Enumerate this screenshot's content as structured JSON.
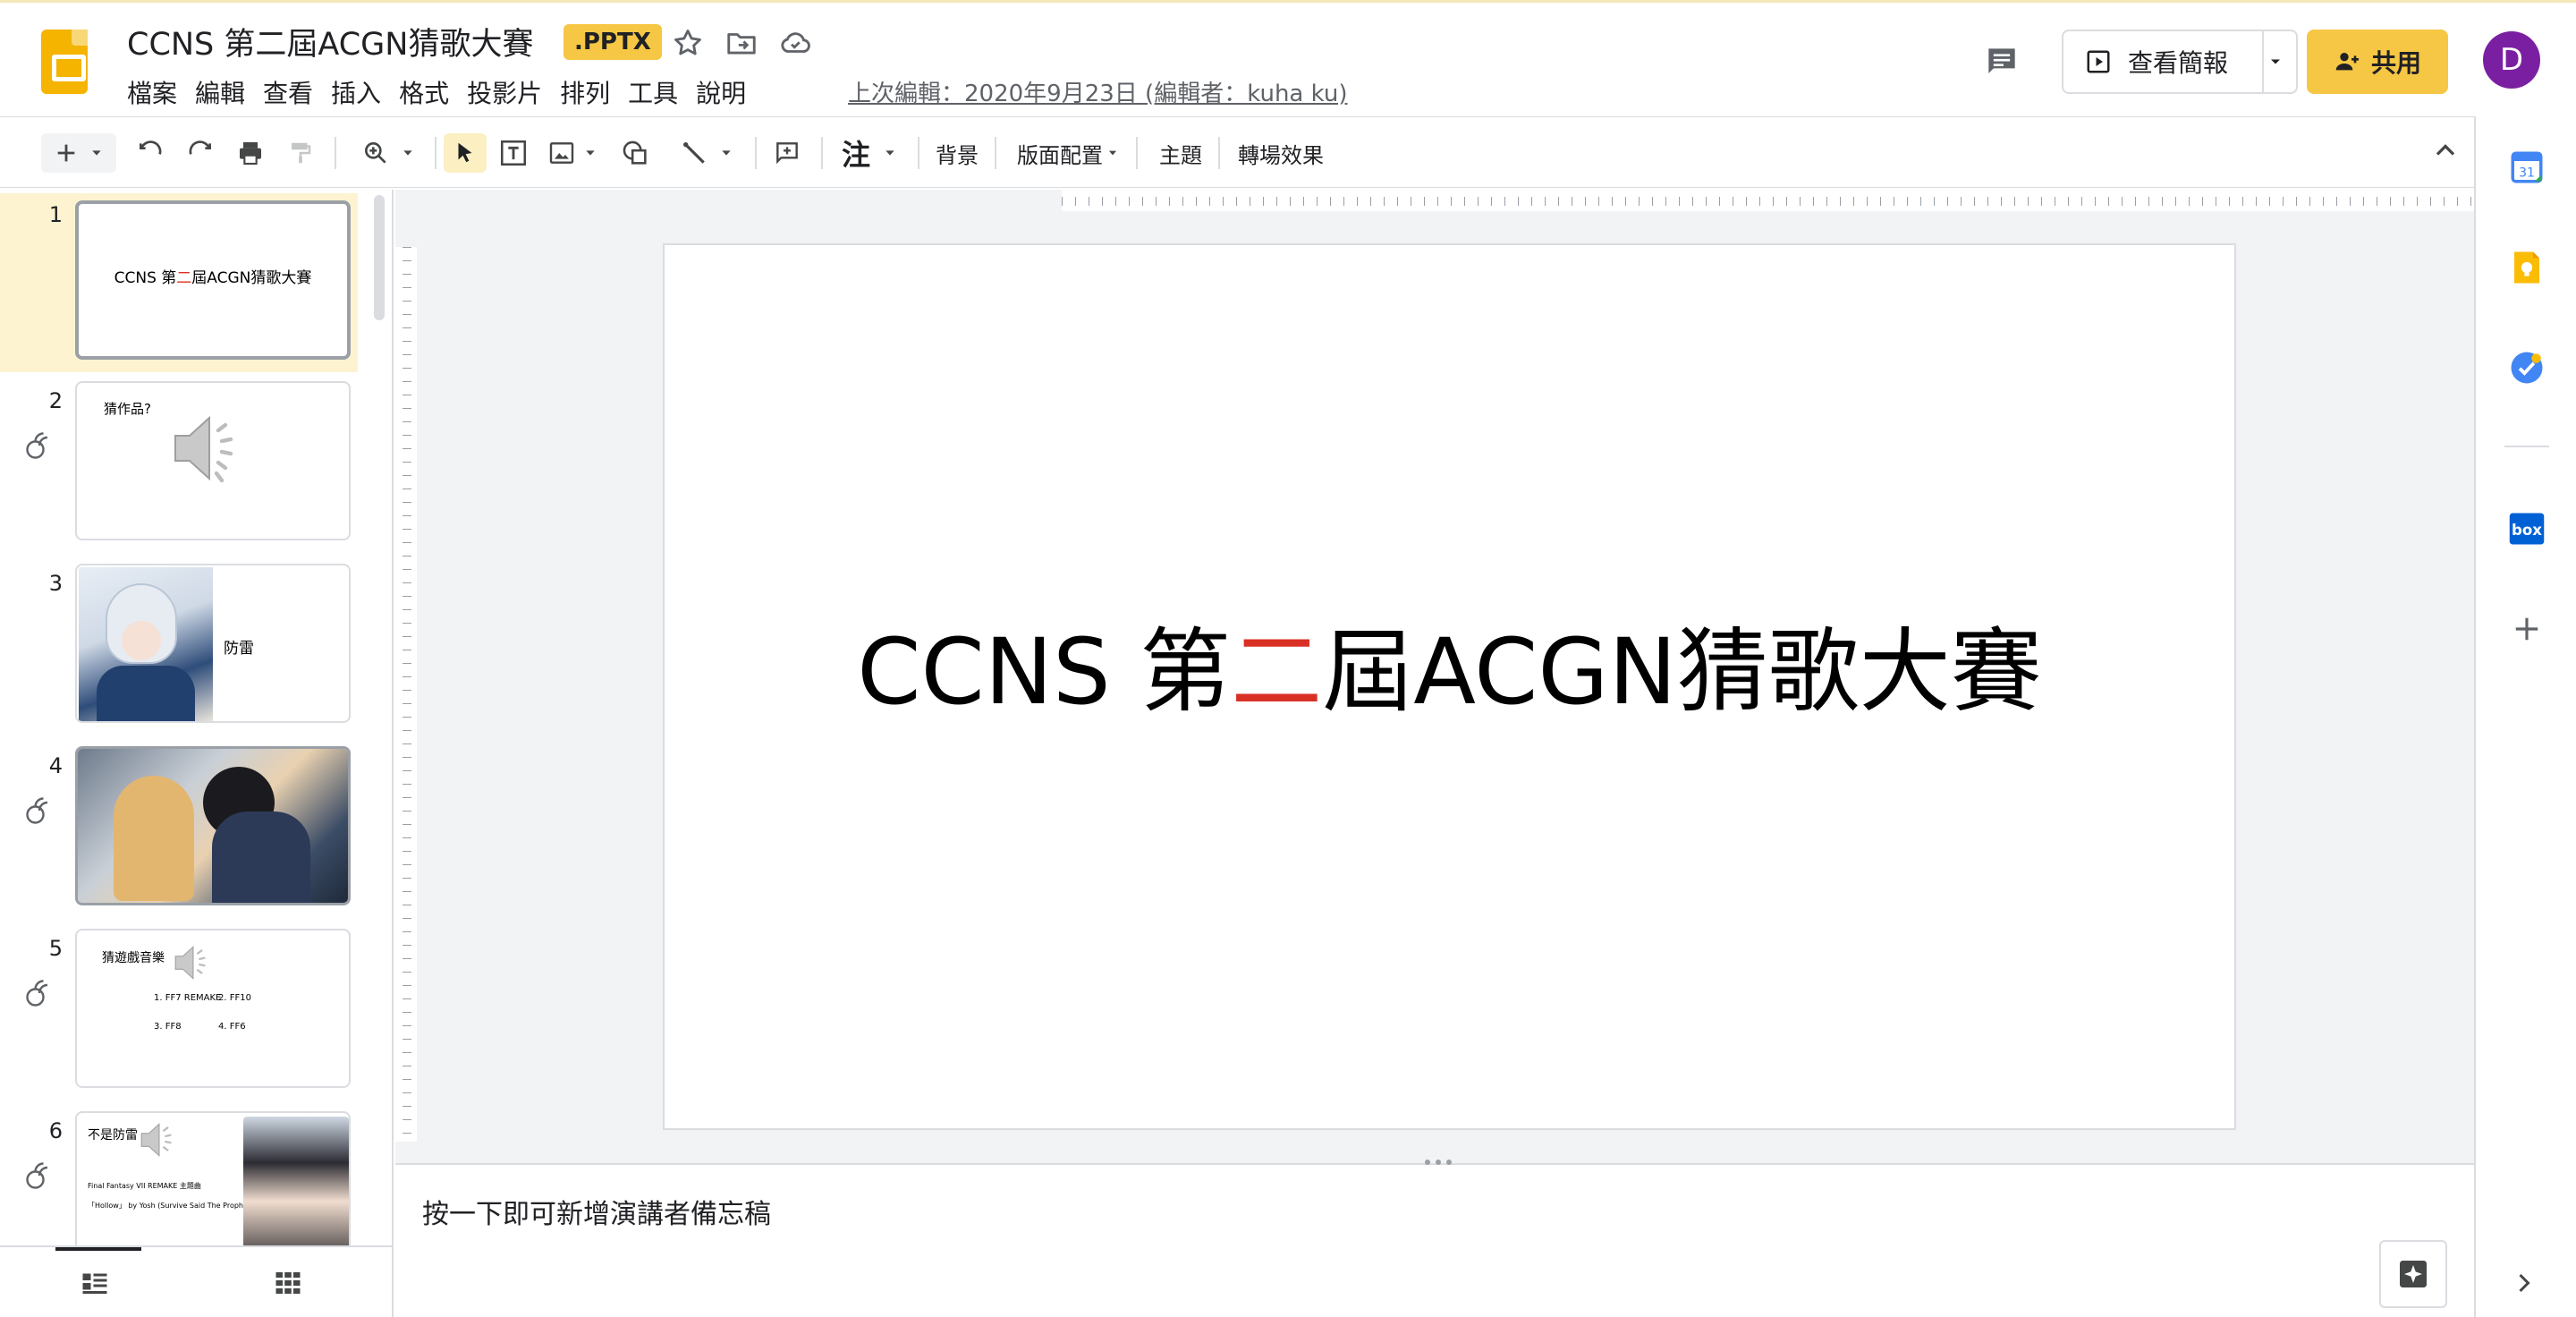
{
  "doc": {
    "title": "CCNS 第二屆ACGN猜歌大賽",
    "badge": ".PPTX",
    "last_edit": "上次編輯：2020年9月23日 (編輯者：kuha ku)"
  },
  "menu": [
    "檔案",
    "編輯",
    "查看",
    "插入",
    "格式",
    "投影片",
    "排列",
    "工具",
    "說明"
  ],
  "header": {
    "present_label": "查看簡報",
    "share_label": "共用",
    "avatar_letter": "D"
  },
  "toolbar": {
    "notes_label": "注",
    "background": "背景",
    "layout": "版面配置",
    "theme": "主題",
    "transition": "轉場效果"
  },
  "slides": [
    {
      "num": "1",
      "title": "CCNS 第二屆ACGN猜歌大賽",
      "title_pre": "CCNS 第",
      "title_red": "二",
      "title_post": "屆ACGN猜歌大賽"
    },
    {
      "num": "2",
      "text": "猜作品?"
    },
    {
      "num": "3",
      "text": "防雷"
    },
    {
      "num": "4"
    },
    {
      "num": "5",
      "text": "猜遊戲音樂",
      "opt1": "1. FF7 REMAKE",
      "opt2": "2.  FF10",
      "opt3": "3. FF8",
      "opt4": "4. FF6"
    },
    {
      "num": "6",
      "text": "不是防雷",
      "line1": "Final Fantasy VII REMAKE 主題曲",
      "line2": "「Hollow」 by Yosh (Survive Said The Prophet)"
    }
  ],
  "main_slide": {
    "title_pre": "CCNS 第",
    "title_red": "二",
    "title_post": "屆ACGN猜歌大賽"
  },
  "notes": {
    "placeholder": "按一下即可新增演講者備忘稿"
  },
  "side_panel": {
    "calendar_day": "31"
  },
  "colors": {
    "accent_yellow": "#f6c744",
    "logo_yellow": "#f4b400",
    "selected_slide_bg": "#fdf3d0",
    "title_red": "#d93025",
    "avatar_purple": "#7b1fa2"
  }
}
